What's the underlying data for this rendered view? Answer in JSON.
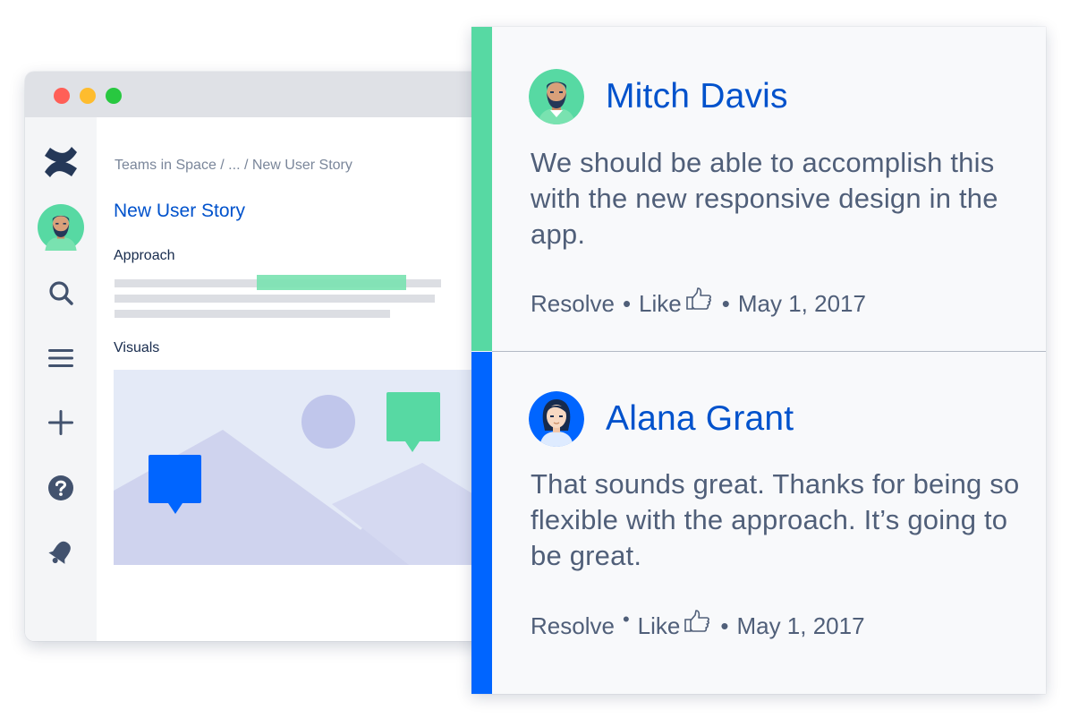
{
  "window": {
    "traffic_lights": {
      "close_color": "#ff5f57",
      "minimize_color": "#febc2e",
      "zoom_color": "#28c840"
    }
  },
  "sidebar": {
    "items": [
      {
        "name": "confluence-logo-icon"
      },
      {
        "name": "avatar"
      },
      {
        "name": "search-icon"
      },
      {
        "name": "menu-icon"
      },
      {
        "name": "create-icon"
      },
      {
        "name": "help-icon"
      },
      {
        "name": "notifications-icon"
      }
    ]
  },
  "content": {
    "breadcrumb": "Teams in Space / ... / New User Story",
    "page_title": "New User Story",
    "approach_heading": "Approach",
    "visuals_heading": "Visuals"
  },
  "comments": [
    {
      "author": "Mitch Davis",
      "body": "We should be able to accomplish this with the new responsive design in the app.",
      "resolve_label": "Resolve",
      "like_label": "Like",
      "date": "May 1, 2017",
      "accent_color": "#57d9a3"
    },
    {
      "author": "Alana Grant",
      "body": "That sounds great. Thanks for being so flexible with the approach. It’s going to be great.",
      "resolve_label": "Resolve",
      "like_label": "Like",
      "date": "May 1, 2017",
      "accent_color": "#0065ff"
    }
  ],
  "colors": {
    "brand_blue": "#0052cc",
    "brand_green": "#57d9a3",
    "accent_blue": "#0065ff",
    "sidebar_icon": "#42526e"
  }
}
